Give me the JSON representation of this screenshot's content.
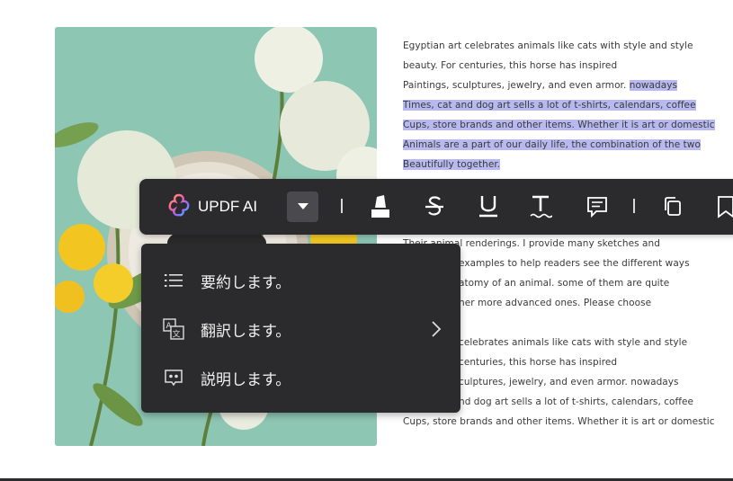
{
  "document": {
    "paragraph1": [
      "Egyptian art celebrates animals like cats with style and style",
      "beauty. For centuries, this horse has inspired",
      "Paintings, sculptures, jewelry, and even armor. ",
      "nowadays",
      "Times, cat and dog art sells a lot of t-shirts, calendars, coffee",
      "Cups, store brands and other items. Whether it is art or domestic",
      "Animals are a part of our daily life, the combination of the two",
      "Beautifully together."
    ],
    "paragraph2": [
      "Their animal renderings. I provide many sketches and",
      "examples to help readers see the different ways",
      "atomy of an animal. some of them are quite",
      "her more advanced ones. Please choose"
    ],
    "paragraph3": [
      "celebrates animals like cats with style and style",
      "centuries, this horse has inspired",
      "culptures, jewelry, and even armor. nowadays",
      "nd dog art sells a lot of t-shirts, calendars, coffee",
      "Cups, store brands and other items. Whether it is art or domestic"
    ]
  },
  "toolbar": {
    "ai_label": "UPDF AI",
    "ai_icon": "updf-ai-logo-icon",
    "tools": [
      "highlight-icon",
      "strikethrough-icon",
      "underline-icon",
      "squiggly-underline-icon",
      "comment-icon",
      "copy-icon",
      "bookmark-icon"
    ]
  },
  "menu": {
    "items": [
      {
        "label": "要約します。",
        "icon": "list-icon"
      },
      {
        "label": "翻訳します。",
        "icon": "translate-icon",
        "has_submenu": true
      },
      {
        "label": "説明します。",
        "icon": "explain-bubble-icon"
      }
    ]
  },
  "colors": {
    "toolbar_bg": "#2b2b2d",
    "highlight": "#b7b9f0",
    "text": "#3a3a3a",
    "photo_bg": "#8cc5b3"
  }
}
